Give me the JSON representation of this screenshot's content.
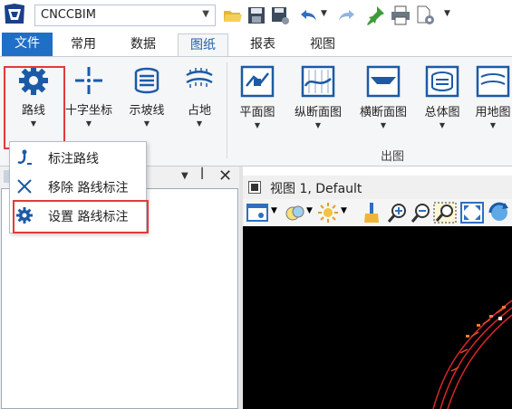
{
  "quick_access": {
    "workspace": "CNCCBIM"
  },
  "tabs": [
    {
      "label": "文件"
    },
    {
      "label": "常用"
    },
    {
      "label": "数据"
    },
    {
      "label": "图纸"
    },
    {
      "label": "报表"
    },
    {
      "label": "视图"
    }
  ],
  "ribbon": {
    "buttons": [
      {
        "label": "路线"
      },
      {
        "label": "十字坐标"
      },
      {
        "label": "示坡线"
      },
      {
        "label": "占地"
      },
      {
        "label": "平面图"
      },
      {
        "label": "纵断面图"
      },
      {
        "label": "横断面图"
      },
      {
        "label": "总体图"
      },
      {
        "label": "用地图"
      }
    ],
    "group_output": "出图"
  },
  "menu": {
    "items": [
      {
        "label": "标注路线",
        "icon": "route-annotate-icon"
      },
      {
        "label": "移除 路线标注",
        "icon": "close-icon"
      },
      {
        "label": "设置 路线标注",
        "icon": "gear-icon"
      }
    ]
  },
  "viewport": {
    "title": "视图 1, Default"
  },
  "colors": {
    "accent": "#1f6fc6",
    "highlight": "#e23a3a",
    "gear": "#1c5aa6"
  }
}
